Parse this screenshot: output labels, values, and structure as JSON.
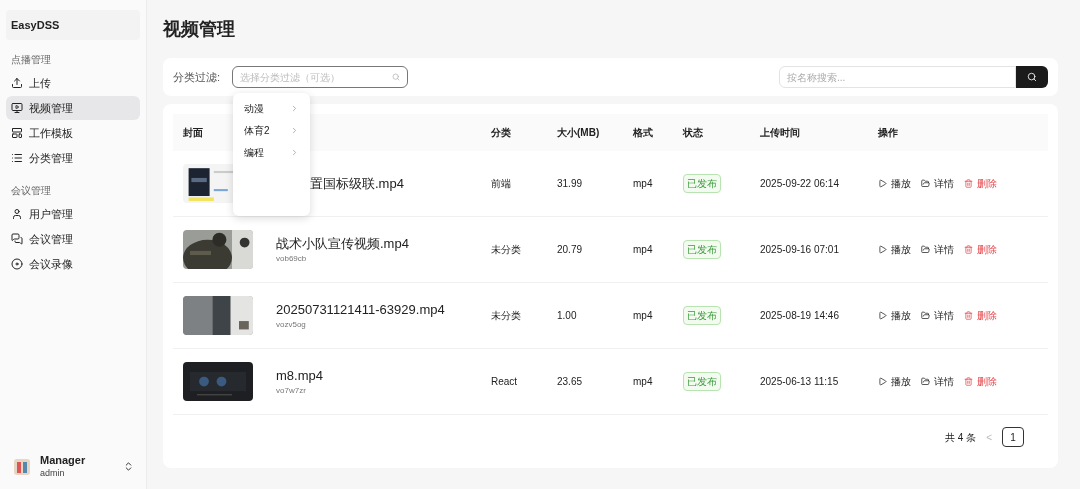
{
  "sidebar": {
    "brand": "EasyDSS",
    "groups": [
      {
        "title": "点播管理",
        "items": [
          {
            "label": "上传",
            "selected": false
          },
          {
            "label": "视频管理",
            "selected": true
          },
          {
            "label": "工作模板",
            "selected": false
          },
          {
            "label": "分类管理",
            "selected": false
          }
        ]
      },
      {
        "title": "会议管理",
        "items": [
          {
            "label": "用户管理",
            "selected": false
          },
          {
            "label": "会议管理",
            "selected": false
          },
          {
            "label": "会议录像",
            "selected": false
          }
        ]
      }
    ],
    "user": {
      "name": "Manager",
      "role": "admin"
    }
  },
  "page_title": "视频管理",
  "filter": {
    "label": "分类过滤:",
    "placeholder": "选择分类过滤（可选）",
    "options": [
      "动漫",
      "体育2",
      "编程"
    ]
  },
  "search": {
    "placeholder": "按名称搜索..."
  },
  "table": {
    "columns": [
      "封面",
      "",
      "分类",
      "大小(MB)",
      "格式",
      "状态",
      "上传时间",
      "操作"
    ],
    "rows": [
      {
        "name": "置国标级联.mp4",
        "covered": true,
        "category": "前端",
        "size": "31.99",
        "format": "mp4",
        "status": "已发布",
        "time": "2025-09-22 06:14",
        "actions": [
          "播放",
          "详情",
          "删除"
        ]
      },
      {
        "name": "战术小队宣传视频.mp4",
        "id": "vob69cb",
        "covered": false,
        "category": "未分类",
        "size": "20.79",
        "format": "mp4",
        "status": "已发布",
        "time": "2025-09-16 07:01",
        "actions": [
          "播放",
          "详情",
          "删除"
        ]
      },
      {
        "name": "20250731121411-63929.mp4",
        "id": "vozv5og",
        "covered": false,
        "category": "未分类",
        "size": "1.00",
        "format": "mp4",
        "status": "已发布",
        "time": "2025-08-19 14:46",
        "actions": [
          "播放",
          "详情",
          "删除"
        ]
      },
      {
        "name": "m8.mp4",
        "id": "vo7w7zr",
        "covered": false,
        "category": "React",
        "size": "23.65",
        "format": "mp4",
        "status": "已发布",
        "time": "2025-06-13 11:15",
        "actions": [
          "播放",
          "详情",
          "删除"
        ]
      }
    ]
  },
  "pagination": {
    "total": "共 4 条",
    "prev": "<",
    "pages": [
      {
        "label": "1",
        "selected": true
      }
    ]
  }
}
